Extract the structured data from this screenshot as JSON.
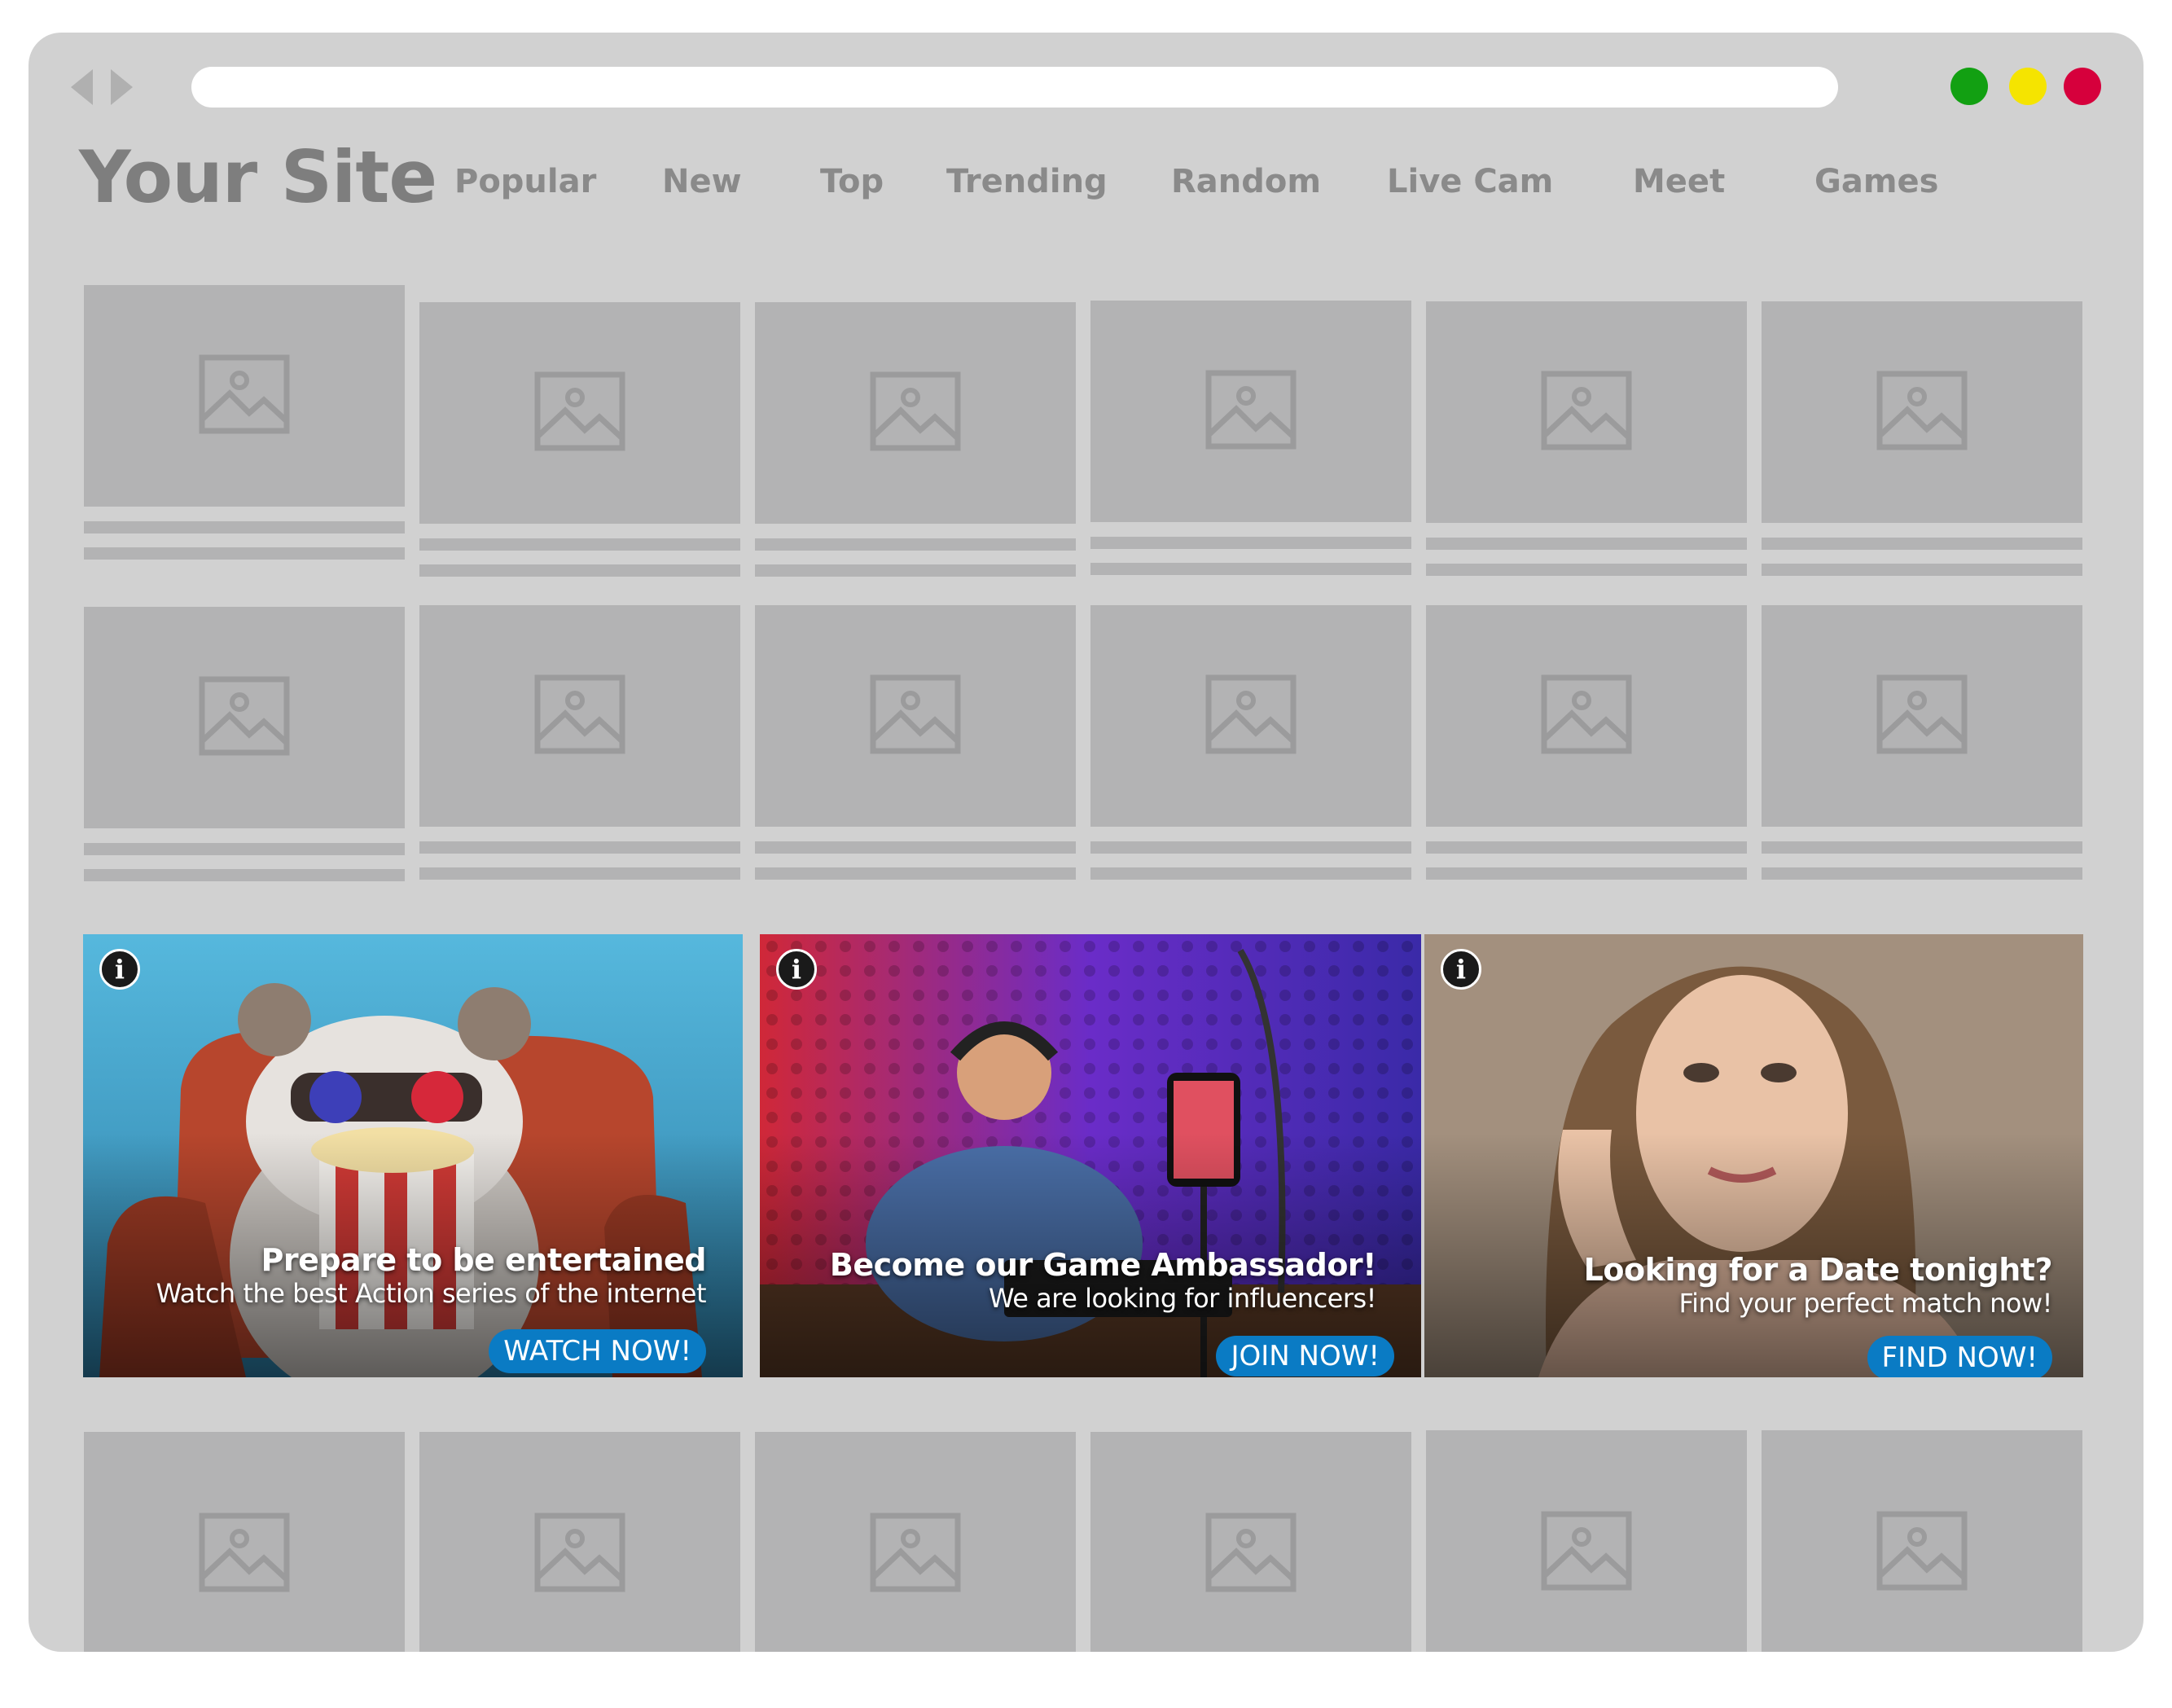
{
  "browser": {
    "address_value": "",
    "window_controls": [
      {
        "name": "green",
        "color": "#12a012"
      },
      {
        "name": "yellow",
        "color": "#f5e400"
      },
      {
        "name": "red",
        "color": "#d6003c"
      }
    ]
  },
  "header": {
    "site_title": "Your Site",
    "menu": [
      "Popular",
      "New",
      "Top",
      "Trending",
      "Random",
      "Live Cam",
      "Meet",
      "Games"
    ]
  },
  "placeholder_icon": "image-placeholder-icon",
  "ads": [
    {
      "info_icon": "i",
      "headline": "Prepare to be entertained",
      "subline": "Watch the best Action series of the internet",
      "cta": "WATCH NOW!",
      "illustration": "raccoon with 3D glasses and popcorn in red armchair",
      "colors": {
        "bg": "#3aa0d0",
        "accent": "#c9452a"
      }
    },
    {
      "info_icon": "i",
      "headline": "Become our Game Ambassador!",
      "subline": "We are looking for influencers!",
      "cta": "JOIN NOW!",
      "illustration": "streamer with headphones at desk with phone on tripod",
      "colors": {
        "bg": "#5a2fd0",
        "accent": "#e0303a"
      }
    },
    {
      "info_icon": "i",
      "headline": "Looking for a Date tonight?",
      "subline": "Find your perfect match now!",
      "cta": "FIND NOW!",
      "illustration": "smiling woman with hand on cheek",
      "colors": {
        "bg": "#a3907e",
        "accent": "#e2b9a0"
      }
    }
  ]
}
